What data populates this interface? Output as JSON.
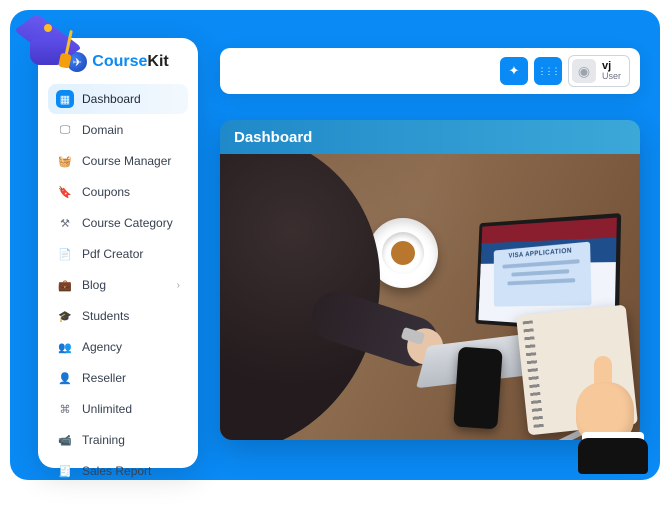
{
  "brand": {
    "part1": "Course",
    "part2": "Kit"
  },
  "sidebar": {
    "items": [
      {
        "label": "Dashboard",
        "icon": "grid-icon",
        "active": true
      },
      {
        "label": "Domain",
        "icon": "monitor-icon"
      },
      {
        "label": "Course Manager",
        "icon": "basket-icon"
      },
      {
        "label": "Coupons",
        "icon": "tag-icon"
      },
      {
        "label": "Course Category",
        "icon": "sliders-icon"
      },
      {
        "label": "Pdf Creator",
        "icon": "file-icon"
      },
      {
        "label": "Blog",
        "icon": "briefcase-icon",
        "hasChildren": true
      },
      {
        "label": "Students",
        "icon": "graduation-icon"
      },
      {
        "label": "Agency",
        "icon": "people-icon"
      },
      {
        "label": "Reseller",
        "icon": "user-icon"
      },
      {
        "label": "Unlimited",
        "icon": "infinity-icon"
      },
      {
        "label": "Training",
        "icon": "video-icon"
      },
      {
        "label": "Sales Report",
        "icon": "report-icon"
      }
    ]
  },
  "topbar": {
    "user": {
      "name": "vj",
      "role": "User"
    }
  },
  "content": {
    "title": "Dashboard",
    "screen_doc_title": "VISA APPLICATION"
  },
  "icons": {
    "grid-icon": "▦",
    "monitor-icon": "🖵",
    "basket-icon": "🧺",
    "tag-icon": "🔖",
    "sliders-icon": "⚒",
    "file-icon": "📄",
    "briefcase-icon": "💼",
    "graduation-icon": "🎓",
    "people-icon": "👥",
    "user-icon": "👤",
    "infinity-icon": "⌘",
    "video-icon": "📹",
    "report-icon": "🧾",
    "magic-icon": "✦",
    "apps-icon": "⋮⋮⋮",
    "avatar-icon": "◉",
    "chevron-right": "›"
  }
}
